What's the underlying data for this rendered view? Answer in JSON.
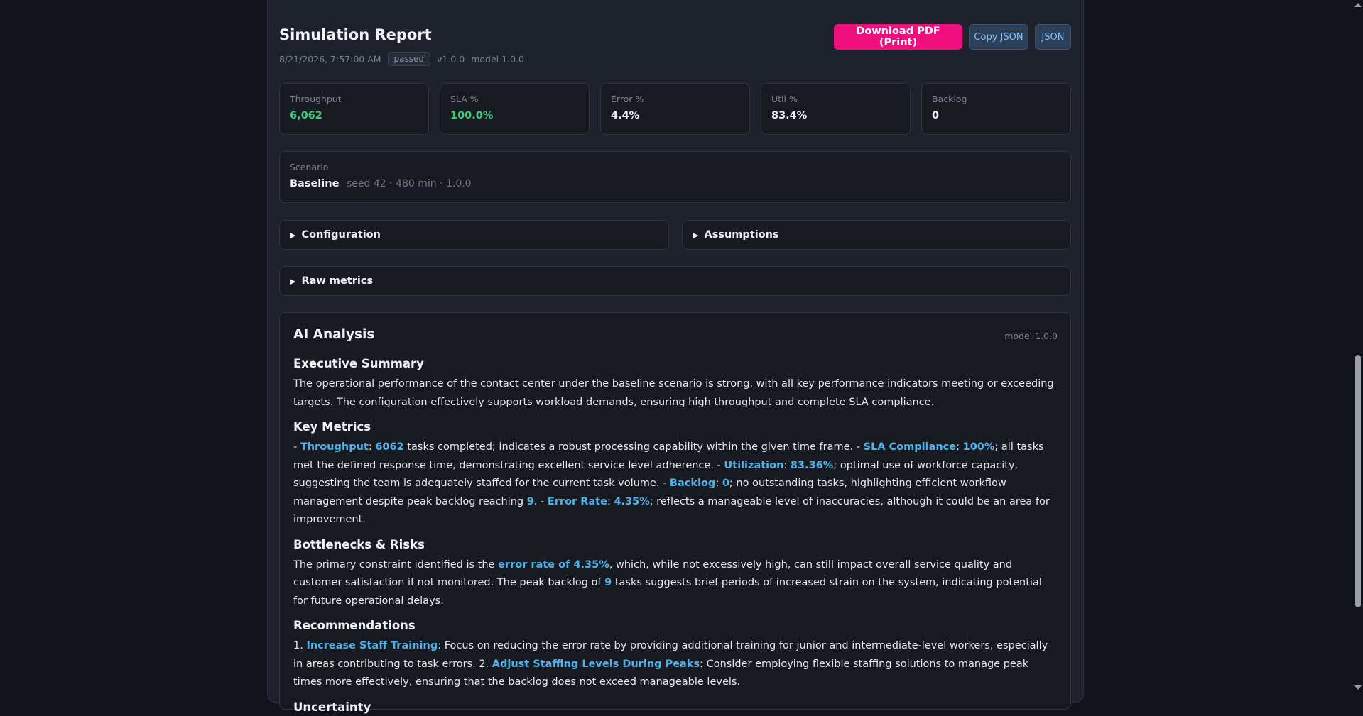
{
  "report": {
    "title": "Simulation Report",
    "timestamp": "8/21/2026, 7:57:00 AM",
    "status": "passed",
    "version": "v1.0.0",
    "model": "model 1.0.0"
  },
  "actions": {
    "download_pdf": "Download PDF (Print)",
    "copy_json": "Copy JSON",
    "json": "JSON"
  },
  "kpis": [
    {
      "label": "Throughput",
      "value": "6,062"
    },
    {
      "label": "SLA %",
      "value": "100.0%"
    },
    {
      "label": "Error %",
      "value": "4.4%"
    },
    {
      "label": "Util %",
      "value": "83.4%"
    },
    {
      "label": "Backlog",
      "value": "0"
    }
  ],
  "scenario": {
    "label": "Scenario",
    "name": "Baseline",
    "details": "seed 42 · 480 min · 1.0.0"
  },
  "sections": {
    "configuration": "Configuration",
    "assumptions": "Assumptions",
    "raw_metrics": "Raw metrics"
  },
  "ai": {
    "title": "AI Analysis",
    "model": "model 1.0.0",
    "exec_title": "Executive Summary",
    "exec_text": "The operational performance of the contact center under the baseline scenario is strong, with all key performance indicators meeting or exceeding targets. The configuration effectively supports workload demands, ensuring high throughput and complete SLA compliance.",
    "key_title": "Key Metrics",
    "km": {
      "t1": "- ",
      "h1": "Throughput",
      "t2": ": ",
      "h2": "6062",
      "t3": " tasks completed; indicates a robust processing capability within the given time frame. - ",
      "h3": "SLA Compliance",
      "t4": ": ",
      "h4": "100%",
      "t5": "; all tasks met the defined response time, demonstrating excellent service level adherence. - ",
      "h5": "Utilization",
      "t6": ": ",
      "h6": "83.36%",
      "t7": "; optimal use of workforce capacity, suggesting the team is adequately staffed for the current task volume. - ",
      "h7": "Backlog",
      "t8": ": ",
      "h8": "0",
      "t9": "; no outstanding tasks, highlighting efficient workflow management despite peak backlog reaching ",
      "h9": "9",
      "t10": ". - ",
      "h10": "Error Rate",
      "t11": ": ",
      "h11": "4.35%",
      "t12": "; reflects a manageable level of inaccuracies, although it could be an area for improvement."
    },
    "risk_title": "Bottlenecks & Risks",
    "risk": {
      "t1": "The primary constraint identified is the ",
      "h1": "error rate of 4.35%",
      "t2": ", which, while not excessively high, can still impact overall service quality and customer satisfaction if not monitored. The peak backlog of ",
      "h2": "9",
      "t3": " tasks suggests brief periods of increased strain on the system, indicating potential for future operational delays."
    },
    "rec_title": "Recommendations",
    "rec": {
      "t1": "1. ",
      "h1": "Increase Staff Training",
      "t2": ": Focus on reducing the error rate by providing additional training for junior and intermediate-level workers, especially in areas contributing to task errors. 2. ",
      "h2": "Adjust Staffing Levels During Peaks",
      "t3": ": Consider employing flexible staffing solutions to manage peak times more effectively, ensuring that the backlog does not exceed manageable levels."
    },
    "uncertainty_title": "Uncertainty"
  },
  "colors": {
    "accent_pink": "#ee0f7c",
    "highlight_blue": "#4db3ec",
    "success_green": "#35d27a",
    "background": "#11131a",
    "panel": "#1d212b"
  }
}
